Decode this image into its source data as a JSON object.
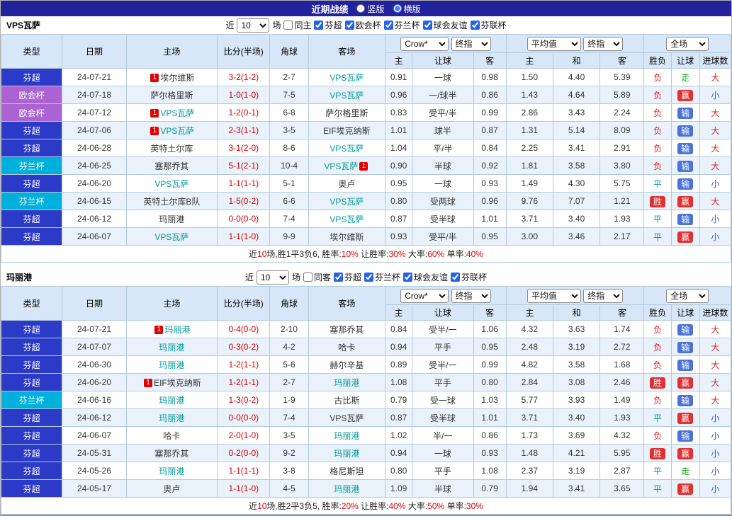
{
  "page": {
    "title": "近期战绩",
    "view_options": [
      {
        "label": "竖版",
        "selected": false
      },
      {
        "label": "横版",
        "selected": true
      }
    ]
  },
  "colors": {
    "topbar_bg": "#22229d",
    "header_bg": "#d7e7f7",
    "league_super": "#2c3ac8",
    "league_euro": "#ab62d2",
    "league_cup": "#00b0dc",
    "focus_team": "#009b9b",
    "score_red": "#d80000",
    "win_badge": "#e03030",
    "lose_badge": "#4a72d8",
    "push_green": "#18a018",
    "over_red": "#e02020",
    "under_blue": "#2a5ad0"
  },
  "table_header": {
    "type": "类型",
    "date": "日期",
    "home": "主场",
    "score": "比分(半场)",
    "corner": "角球",
    "away": "客场",
    "odds_selects": [
      "Crow*",
      "终指"
    ],
    "avg_selects": [
      "平均值",
      "终指"
    ],
    "full_select": "全场",
    "odds_sub": [
      "主",
      "让球",
      "客"
    ],
    "avg_sub": [
      "主",
      "和",
      "客"
    ],
    "result_sub": [
      "胜负",
      "让球",
      "进球数"
    ]
  },
  "sections": [
    {
      "team": "VPS瓦萨",
      "filter": {
        "near": "近",
        "count": "10",
        "games": "场",
        "same": "同主",
        "same_checked": false,
        "leagues": [
          {
            "label": "芬超",
            "checked": true
          },
          {
            "label": "欧会杯",
            "checked": true
          },
          {
            "label": "芬兰杯",
            "checked": true
          },
          {
            "label": "球会友谊",
            "checked": true
          },
          {
            "label": "芬联杯",
            "checked": true
          }
        ]
      },
      "rows": [
        {
          "league": "芬超",
          "league_kind": "super",
          "date": "24-07-21",
          "home": "埃尔维斯",
          "home_badge": "1",
          "score": "3-2(1-2)",
          "corner": "2-7",
          "away": "VPS瓦萨",
          "away_focus": true,
          "odds": [
            "0.91",
            "一球",
            "0.98"
          ],
          "avg": [
            "1.50",
            "4.40",
            "5.39"
          ],
          "result": "负",
          "result_kind": "loss",
          "handicap": "走",
          "handicap_kind": "push",
          "goals": "大",
          "goals_kind": "over"
        },
        {
          "league": "欧会杯",
          "league_kind": "euro",
          "date": "24-07-18",
          "home": "萨尔格里斯",
          "score": "1-0(1-0)",
          "corner": "7-5",
          "away": "VPS瓦萨",
          "away_focus": true,
          "odds": [
            "0.96",
            "一/球半",
            "0.86"
          ],
          "avg": [
            "1.43",
            "4.64",
            "5.89"
          ],
          "result": "负",
          "result_kind": "loss",
          "handicap": "赢",
          "handicap_kind": "win",
          "goals": "小",
          "goals_kind": "under"
        },
        {
          "league": "欧会杯",
          "league_kind": "euro",
          "date": "24-07-12",
          "home": "VPS瓦萨",
          "home_badge": "1",
          "home_focus": true,
          "score": "1-2(0-1)",
          "corner": "6-8",
          "away": "萨尔格里斯",
          "odds": [
            "0.83",
            "受平/半",
            "0.99"
          ],
          "avg": [
            "2.86",
            "3.43",
            "2.24"
          ],
          "result": "负",
          "result_kind": "loss",
          "handicap": "输",
          "handicap_kind": "lose",
          "goals": "大",
          "goals_kind": "over"
        },
        {
          "league": "芬超",
          "league_kind": "super",
          "date": "24-07-06",
          "home": "VPS瓦萨",
          "home_badge": "1",
          "home_focus": true,
          "score": "2-3(1-1)",
          "corner": "3-5",
          "away": "EIF埃克纳斯",
          "odds": [
            "1.01",
            "球半",
            "0.87"
          ],
          "avg": [
            "1.31",
            "5.14",
            "8.09"
          ],
          "result": "负",
          "result_kind": "loss",
          "handicap": "输",
          "handicap_kind": "lose",
          "goals": "大",
          "goals_kind": "over"
        },
        {
          "league": "芬超",
          "league_kind": "super",
          "date": "24-06-28",
          "home": "英特土尔库",
          "score": "3-1(2-0)",
          "corner": "8-6",
          "away": "VPS瓦萨",
          "away_focus": true,
          "odds": [
            "1.04",
            "平/半",
            "0.84"
          ],
          "avg": [
            "2.25",
            "3.41",
            "2.91"
          ],
          "result": "负",
          "result_kind": "loss",
          "handicap": "输",
          "handicap_kind": "lose",
          "goals": "大",
          "goals_kind": "over"
        },
        {
          "league": "芬兰杯",
          "league_kind": "cup",
          "date": "24-06-25",
          "home": "塞那乔其",
          "score": "5-1(2-1)",
          "corner": "10-4",
          "away": "VPS瓦萨",
          "away_badge": "1",
          "away_focus": true,
          "odds": [
            "0.90",
            "半球",
            "0.92"
          ],
          "avg": [
            "1.81",
            "3.58",
            "3.80"
          ],
          "result": "负",
          "result_kind": "loss",
          "handicap": "输",
          "handicap_kind": "lose",
          "goals": "大",
          "goals_kind": "over"
        },
        {
          "league": "芬超",
          "league_kind": "super",
          "date": "24-06-20",
          "home": "VPS瓦萨",
          "home_focus": true,
          "score": "1-1(1-1)",
          "corner": "5-1",
          "away": "奥卢",
          "odds": [
            "0.95",
            "一球",
            "0.93"
          ],
          "avg": [
            "1.49",
            "4.30",
            "5.75"
          ],
          "result": "平",
          "result_kind": "draw",
          "handicap": "输",
          "handicap_kind": "lose",
          "goals": "小",
          "goals_kind": "under"
        },
        {
          "league": "芬兰杯",
          "league_kind": "cup",
          "date": "24-06-15",
          "home": "英特土尔库B队",
          "score": "1-5(0-2)",
          "corner": "6-6",
          "away": "VPS瓦萨",
          "away_focus": true,
          "odds": [
            "0.80",
            "受两球",
            "0.96"
          ],
          "avg": [
            "9.76",
            "7.07",
            "1.21"
          ],
          "result": "胜",
          "result_kind": "win",
          "handicap": "赢",
          "handicap_kind": "win",
          "goals": "大",
          "goals_kind": "over"
        },
        {
          "league": "芬超",
          "league_kind": "super",
          "date": "24-06-12",
          "home": "玛丽港",
          "score": "0-0(0-0)",
          "corner": "7-4",
          "away": "VPS瓦萨",
          "away_focus": true,
          "odds": [
            "0.87",
            "受半球",
            "1.01"
          ],
          "avg": [
            "3.71",
            "3.40",
            "1.93"
          ],
          "result": "平",
          "result_kind": "draw",
          "handicap": "输",
          "handicap_kind": "lose",
          "goals": "小",
          "goals_kind": "under"
        },
        {
          "league": "芬超",
          "league_kind": "super",
          "date": "24-06-07",
          "home": "VPS瓦萨",
          "home_focus": true,
          "score": "1-1(1-0)",
          "corner": "9-9",
          "away": "埃尔维斯",
          "odds": [
            "0.93",
            "受平/半",
            "0.95"
          ],
          "avg": [
            "3.00",
            "3.46",
            "2.17"
          ],
          "result": "平",
          "result_kind": "draw",
          "handicap": "赢",
          "handicap_kind": "win",
          "goals": "小",
          "goals_kind": "under"
        }
      ],
      "summary": [
        {
          "text": "近",
          "red": false
        },
        {
          "text": "10",
          "red": true
        },
        {
          "text": "场,胜1平3负6, ",
          "red": false
        },
        {
          "text": "胜率:",
          "red": false
        },
        {
          "text": "10%",
          "red": true
        },
        {
          "text": " 让胜率:",
          "red": false
        },
        {
          "text": "30%",
          "red": true
        },
        {
          "text": " 大率:",
          "red": false
        },
        {
          "text": "60%",
          "red": true
        },
        {
          "text": " 单率:",
          "red": false
        },
        {
          "text": "40%",
          "red": true
        }
      ]
    },
    {
      "team": "玛丽港",
      "filter": {
        "near": "近",
        "count": "10",
        "games": "场",
        "same": "同客",
        "same_checked": false,
        "leagues": [
          {
            "label": "芬超",
            "checked": true
          },
          {
            "label": "芬兰杯",
            "checked": true
          },
          {
            "label": "球会友谊",
            "checked": true
          },
          {
            "label": "芬联杯",
            "checked": true
          }
        ]
      },
      "rows": [
        {
          "league": "芬超",
          "league_kind": "super",
          "date": "24-07-21",
          "home": "玛丽港",
          "home_badge": "1",
          "home_focus": true,
          "score": "0-4(0-0)",
          "corner": "2-10",
          "away": "塞那乔其",
          "odds": [
            "0.84",
            "受半/一",
            "1.06"
          ],
          "avg": [
            "4.32",
            "3.63",
            "1.74"
          ],
          "result": "负",
          "result_kind": "loss",
          "handicap": "输",
          "handicap_kind": "lose",
          "goals": "大",
          "goals_kind": "over"
        },
        {
          "league": "芬超",
          "league_kind": "super",
          "date": "24-07-07",
          "home": "玛丽港",
          "home_focus": true,
          "score": "0-3(0-2)",
          "corner": "4-2",
          "away": "哈卡",
          "odds": [
            "0.94",
            "平手",
            "0.95"
          ],
          "avg": [
            "2.48",
            "3.19",
            "2.72"
          ],
          "result": "负",
          "result_kind": "loss",
          "handicap": "输",
          "handicap_kind": "lose",
          "goals": "大",
          "goals_kind": "over"
        },
        {
          "league": "芬超",
          "league_kind": "super",
          "date": "24-06-30",
          "home": "玛丽港",
          "home_focus": true,
          "score": "1-2(1-1)",
          "corner": "5-6",
          "away": "赫尔辛基",
          "odds": [
            "0.89",
            "受半/一",
            "0.99"
          ],
          "avg": [
            "4.82",
            "3.58",
            "1.68"
          ],
          "result": "负",
          "result_kind": "loss",
          "handicap": "输",
          "handicap_kind": "lose",
          "goals": "大",
          "goals_kind": "over"
        },
        {
          "league": "芬超",
          "league_kind": "super",
          "date": "24-06-20",
          "home": "EIF埃克纳斯",
          "home_badge": "1",
          "score": "1-2(1-1)",
          "corner": "2-7",
          "away": "玛丽港",
          "away_focus": true,
          "odds": [
            "1.08",
            "平手",
            "0.80"
          ],
          "avg": [
            "2.84",
            "3.08",
            "2.46"
          ],
          "result": "胜",
          "result_kind": "win",
          "handicap": "赢",
          "handicap_kind": "win",
          "goals": "大",
          "goals_kind": "over"
        },
        {
          "league": "芬兰杯",
          "league_kind": "cup",
          "date": "24-06-16",
          "home": "玛丽港",
          "home_focus": true,
          "score": "1-3(0-2)",
          "corner": "1-9",
          "away": "古比斯",
          "odds": [
            "0.79",
            "受一球",
            "1.03"
          ],
          "avg": [
            "5.77",
            "3.93",
            "1.49"
          ],
          "result": "负",
          "result_kind": "loss",
          "handicap": "输",
          "handicap_kind": "lose",
          "goals": "大",
          "goals_kind": "over"
        },
        {
          "league": "芬超",
          "league_kind": "super",
          "date": "24-06-12",
          "home": "玛丽港",
          "home_focus": true,
          "score": "0-0(0-0)",
          "corner": "7-4",
          "away": "VPS瓦萨",
          "odds": [
            "0.87",
            "受半球",
            "1.01"
          ],
          "avg": [
            "3.71",
            "3.40",
            "1.93"
          ],
          "result": "平",
          "result_kind": "draw",
          "handicap": "赢",
          "handicap_kind": "win",
          "goals": "小",
          "goals_kind": "under"
        },
        {
          "league": "芬超",
          "league_kind": "super",
          "date": "24-06-07",
          "home": "哈卡",
          "score": "2-0(1-0)",
          "corner": "3-5",
          "away": "玛丽港",
          "away_focus": true,
          "odds": [
            "1.02",
            "半/一",
            "0.86"
          ],
          "avg": [
            "1.73",
            "3.69",
            "4.32"
          ],
          "result": "负",
          "result_kind": "loss",
          "handicap": "输",
          "handicap_kind": "lose",
          "goals": "小",
          "goals_kind": "under"
        },
        {
          "league": "芬超",
          "league_kind": "super",
          "date": "24-05-31",
          "home": "塞那乔其",
          "score": "0-2(0-0)",
          "corner": "9-2",
          "away": "玛丽港",
          "away_focus": true,
          "odds": [
            "0.94",
            "一球",
            "0.93"
          ],
          "avg": [
            "1.48",
            "4.21",
            "5.95"
          ],
          "result": "胜",
          "result_kind": "win",
          "handicap": "赢",
          "handicap_kind": "win",
          "goals": "小",
          "goals_kind": "under"
        },
        {
          "league": "芬超",
          "league_kind": "super",
          "date": "24-05-26",
          "home": "玛丽港",
          "home_focus": true,
          "score": "1-1(1-1)",
          "corner": "3-8",
          "away": "格尼斯坦",
          "odds": [
            "0.80",
            "平手",
            "1.08"
          ],
          "avg": [
            "2.37",
            "3.19",
            "2.87"
          ],
          "result": "平",
          "result_kind": "draw",
          "handicap": "走",
          "handicap_kind": "push",
          "goals": "小",
          "goals_kind": "under"
        },
        {
          "league": "芬超",
          "league_kind": "super",
          "date": "24-05-17",
          "home": "奥卢",
          "score": "1-1(1-0)",
          "corner": "4-5",
          "away": "玛丽港",
          "away_focus": true,
          "odds": [
            "1.09",
            "半球",
            "0.79"
          ],
          "avg": [
            "1.94",
            "3.41",
            "3.65"
          ],
          "result": "平",
          "result_kind": "draw",
          "handicap": "赢",
          "handicap_kind": "win",
          "goals": "小",
          "goals_kind": "under"
        }
      ],
      "summary": [
        {
          "text": "近",
          "red": false
        },
        {
          "text": "10",
          "red": true
        },
        {
          "text": "场,胜2平3负5, ",
          "red": false
        },
        {
          "text": "胜率:",
          "red": false
        },
        {
          "text": "20%",
          "red": true
        },
        {
          "text": " 让胜率:",
          "red": false
        },
        {
          "text": "40%",
          "red": true
        },
        {
          "text": " 大率:",
          "red": false
        },
        {
          "text": "50%",
          "red": true
        },
        {
          "text": " 单率:",
          "red": false
        },
        {
          "text": "30%",
          "red": true
        }
      ]
    }
  ]
}
